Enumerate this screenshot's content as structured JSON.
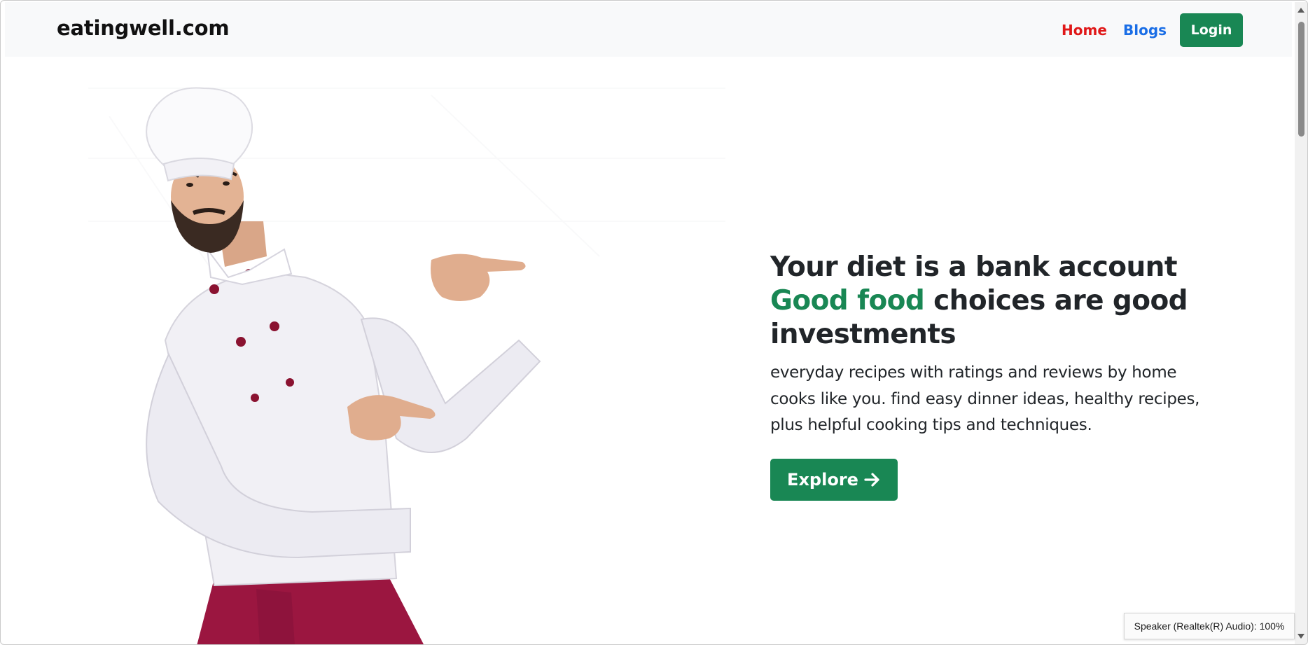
{
  "navbar": {
    "brand": "eatingwell.com",
    "links": [
      {
        "label": "Home",
        "color": "#e01818"
      },
      {
        "label": "Blogs",
        "color": "#1a6ee6"
      }
    ],
    "login_label": "Login"
  },
  "hero": {
    "headline_part1": "Your diet is a bank account ",
    "headline_accent": "Good food",
    "headline_part2": " choices are good investments",
    "lead": "everyday recipes with ratings and reviews by home cooks like you. find easy dinner ideas, healthy recipes, plus helpful cooking tips and techniques.",
    "explore_label": "Explore",
    "explore_icon": "arrow-right-icon",
    "image_icon": "chef-pointing-image"
  },
  "system": {
    "tooltip": "Speaker (Realtek(R) Audio): 100%"
  },
  "colors": {
    "accent": "#198754",
    "navbar_bg": "#f8f9fa",
    "home_link": "#e01818",
    "blogs_link": "#1a6ee6"
  }
}
